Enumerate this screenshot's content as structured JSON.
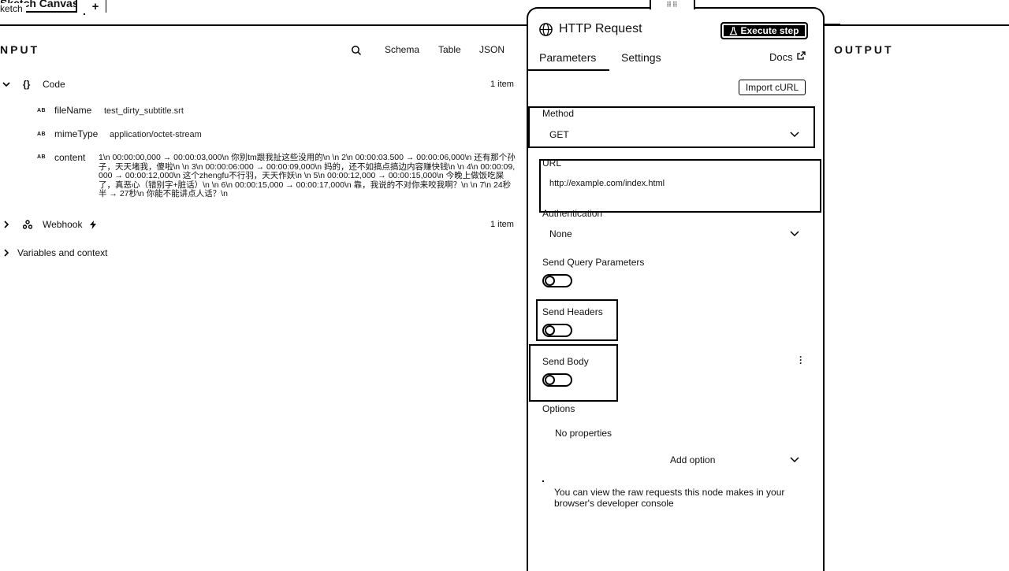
{
  "tabs": {
    "active_label": "Sketch Canvas",
    "sub_label": "ketch",
    "add_label": "+"
  },
  "input": {
    "title": "NPUT",
    "modes": [
      "Schema",
      "Table",
      "JSON"
    ],
    "code_group": {
      "icon": "{}",
      "label": "Code",
      "count": "1 item"
    },
    "fields": [
      {
        "type": "AB",
        "key": "fileName",
        "value": "test_dirty_subtitle.srt"
      },
      {
        "type": "AB",
        "key": "mimeType",
        "value": "application/octet-stream"
      },
      {
        "type": "AB",
        "key": "content",
        "value": "1\\n 00:00:00,000 → 00:00:03,000\\n 你别tm跟我扯这些没用的\\n \\n 2\\n 00:00:03.500 → 00:00:06,000\\n 还有那个孙子，天天堵我，傻啦\\n \\n 3\\n 00:00:06:000 → 00:00:09,000\\n 妈的，还不如搞点搞边内容赚快钱\\n \\n 4\\n 00:00:09,000 → 00:00:12,000\\n 这个zhengfu不行羽，天天作妖\\n \\n 5\\n 00:00:12,000 → 00:00:15,000\\n 今晚上做饭吃屎了，真恶心（错别字+脏话）\\n \\n 6\\n 00:00:15,000 → 00:00:17,000\\n 靠，我说的不对你来咬我啊？\\n \\n 7\\n 24秒半 → 27秒\\n 你能不能讲点人话？\\n"
      }
    ],
    "webhook_group": {
      "label": "Webhook",
      "count": "1 item"
    },
    "variables_label": "Variables and context"
  },
  "node": {
    "title": "HTTP Request",
    "execute_label": "Execute step",
    "tabs": [
      "Parameters",
      "Settings"
    ],
    "docs_label": "Docs",
    "import_curl_label": "Import cURL",
    "method": {
      "label": "Method",
      "value": "GET"
    },
    "url": {
      "label": "URL",
      "value": "http://example.com/index.html"
    },
    "authentication": {
      "label": "Authentication",
      "value": "None"
    },
    "send_query": {
      "label": "Send Query Parameters"
    },
    "send_headers": {
      "label": "Send Headers"
    },
    "send_body": {
      "label": "Send Body"
    },
    "options": {
      "label": "Options",
      "empty": "No properties",
      "add_label": "Add option"
    },
    "note": "You can view the raw requests this node makes in your browser's developer console"
  },
  "output": {
    "title": "OUTPUT"
  }
}
